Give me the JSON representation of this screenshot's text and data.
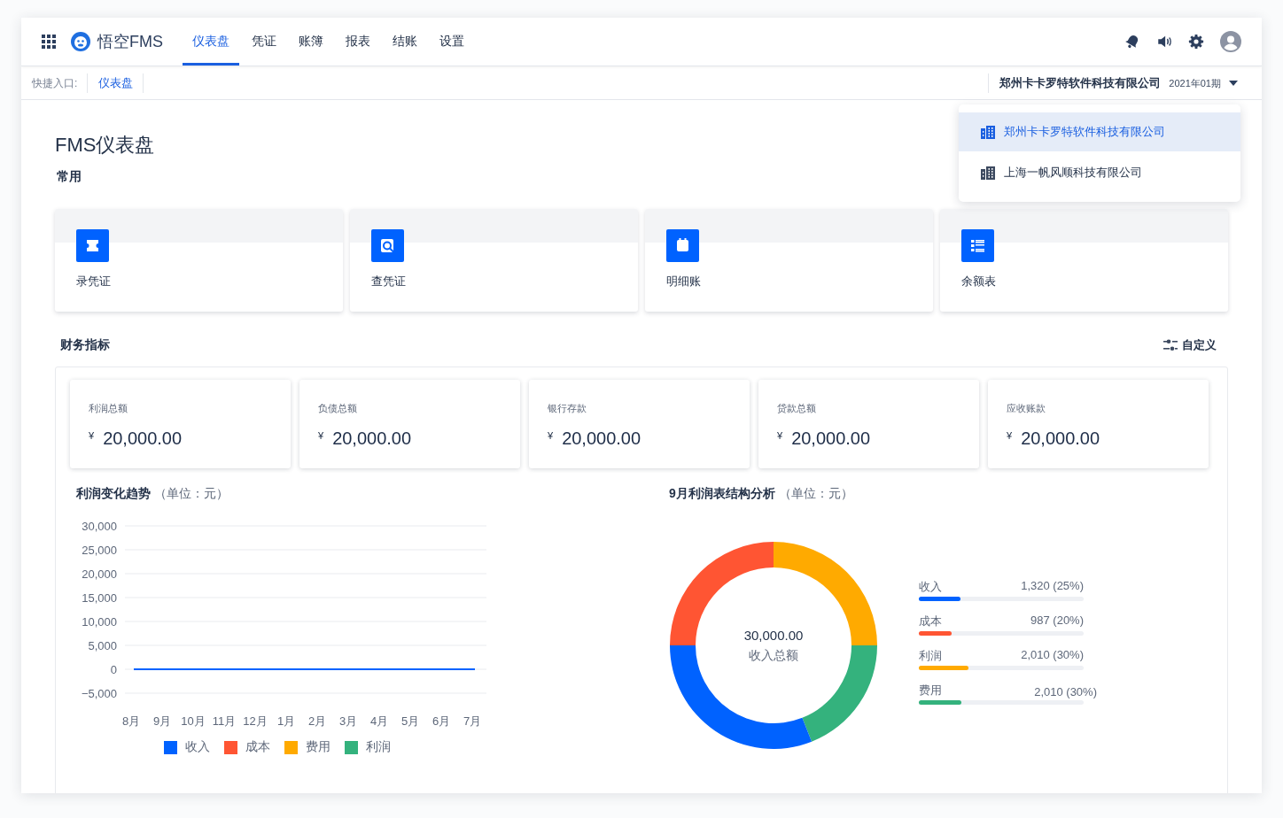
{
  "app": {
    "name": "悟空FMS"
  },
  "nav": {
    "tabs": [
      {
        "label": "仪表盘",
        "selected": true
      },
      {
        "label": "凭证",
        "selected": false
      },
      {
        "label": "账簿",
        "selected": false
      },
      {
        "label": "报表",
        "selected": false
      },
      {
        "label": "结账",
        "selected": false
      },
      {
        "label": "设置",
        "selected": false
      }
    ]
  },
  "shortcut_bar": {
    "label": "快捷入口:",
    "links": [
      "仪表盘"
    ],
    "company": "郑州卡卡罗特软件科技有限公司",
    "period": "2021年01期"
  },
  "company_menu": {
    "items": [
      {
        "label": "郑州卡卡罗特软件科技有限公司",
        "selected": true
      },
      {
        "label": "上海一帆风顺科技有限公司",
        "selected": false
      }
    ]
  },
  "page": {
    "title": "FMS仪表盘",
    "frequent_heading": "常用",
    "shortcuts": [
      {
        "label": "录凭证",
        "kind": "entry"
      },
      {
        "label": "查凭证",
        "kind": "search"
      },
      {
        "label": "明细账",
        "kind": "ledger"
      },
      {
        "label": "余额表",
        "kind": "list"
      }
    ]
  },
  "indicators": {
    "heading": "财务指标",
    "customize_button": "自定义",
    "cards": [
      {
        "label": "利润总额",
        "currency": "¥",
        "value": "20,000.00"
      },
      {
        "label": "负债总额",
        "currency": "¥",
        "value": "20,000.00"
      },
      {
        "label": "银行存款",
        "currency": "¥",
        "value": "20,000.00"
      },
      {
        "label": "贷款总额",
        "currency": "¥",
        "value": "20,000.00"
      },
      {
        "label": "应收账款",
        "currency": "¥",
        "value": "20,000.00"
      }
    ]
  },
  "trend_chart": {
    "title": "利润变化趋势",
    "unit": "（单位：元）",
    "chart_data": {
      "type": "line",
      "categories": [
        "8月",
        "9月",
        "10月",
        "11月",
        "12月",
        "1月",
        "2月",
        "3月",
        "4月",
        "5月",
        "6月",
        "7月"
      ],
      "series": [
        {
          "name": "收入",
          "color": "#0062ff",
          "values": [
            0,
            0,
            0,
            0,
            0,
            0,
            0,
            0,
            0,
            0,
            0,
            0
          ]
        },
        {
          "name": "成本",
          "color": "#ff5533",
          "values": [
            null,
            null,
            null,
            null,
            null,
            null,
            null,
            null,
            null,
            null,
            null,
            null
          ]
        },
        {
          "name": "费用",
          "color": "#ffaa00",
          "values": [
            null,
            null,
            null,
            null,
            null,
            null,
            null,
            null,
            null,
            null,
            null,
            null
          ]
        },
        {
          "name": "利润",
          "color": "#34b27d",
          "values": [
            null,
            null,
            null,
            null,
            null,
            null,
            null,
            null,
            null,
            null,
            null,
            null
          ]
        }
      ],
      "grid": true,
      "ylim": [
        -5000,
        30000
      ],
      "yticks": [
        {
          "value": 30000,
          "label": "30,000"
        },
        {
          "value": 25000,
          "label": "25,000"
        },
        {
          "value": 20000,
          "label": "20,000"
        },
        {
          "value": 15000,
          "label": "15,000"
        },
        {
          "value": 10000,
          "label": "10,000"
        },
        {
          "value": 5000,
          "label": "5,000"
        },
        {
          "value": 0,
          "label": "0"
        },
        {
          "value": -5000,
          "label": "−5,000"
        }
      ]
    }
  },
  "structure": {
    "title": "9月利润表结构分析",
    "unit": "（单位：元）",
    "total": "30,000.00",
    "total_label": "收入总额",
    "items": [
      {
        "name": "收入",
        "reading": "1,320 (25%)",
        "level": 0.25,
        "color": "#0062ff"
      },
      {
        "name": "成本",
        "reading": "987 (20%)",
        "level": 0.2,
        "color": "#ff5533"
      },
      {
        "name": "利润",
        "reading": "2,010 (30%)",
        "level": 0.3,
        "color": "#ffaa00"
      },
      {
        "name": "费用",
        "reading": "2,010 (30%)",
        "level": 0.26,
        "color": "#34b27d"
      }
    ]
  }
}
